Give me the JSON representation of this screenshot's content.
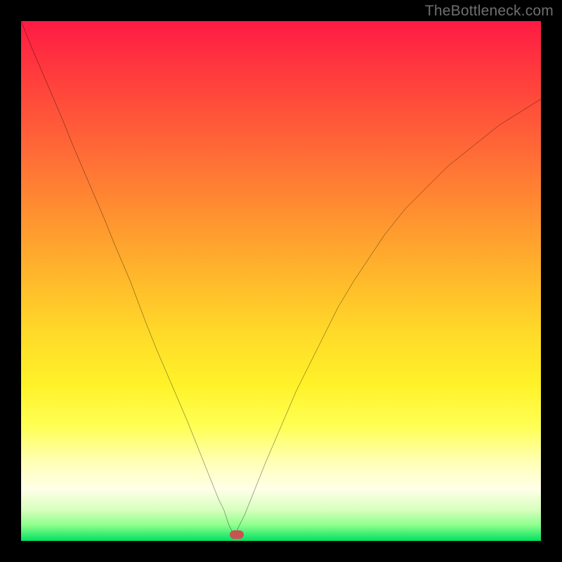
{
  "watermark": "TheBottleneck.com",
  "colors": {
    "frame": "#000000",
    "curve": "#000000",
    "marker": "#c95252"
  },
  "chart_data": {
    "type": "line",
    "title": "",
    "xlabel": "",
    "ylabel": "",
    "xlim": [
      0,
      100
    ],
    "ylim": [
      0,
      100
    ],
    "grid": false,
    "note": "x and y are percent of plot width/height; y=0 is bottom. Curve is a V-shaped function with a sharp minimum near x≈41.",
    "series": [
      {
        "name": "curve",
        "x": [
          0,
          2,
          5,
          8,
          10,
          13,
          16,
          18,
          21,
          24,
          26,
          29,
          32,
          34,
          36,
          38,
          39,
          40,
          41,
          42,
          43,
          45,
          47,
          50,
          53,
          56,
          58,
          61,
          64,
          66,
          70,
          74,
          78,
          82,
          87,
          92,
          100
        ],
        "y": [
          100,
          95,
          88,
          81,
          76,
          69,
          62,
          57,
          50,
          42,
          37,
          30,
          23,
          18,
          13,
          8,
          6,
          3,
          1,
          3,
          5,
          10,
          15,
          22,
          29,
          35,
          39,
          45,
          50,
          53,
          59,
          64,
          68,
          72,
          76,
          80,
          85
        ]
      }
    ],
    "marker": {
      "x": 41.5,
      "y": 1.2
    },
    "background_gradient": [
      {
        "stop": 0,
        "color": "#ff1a44"
      },
      {
        "stop": 10,
        "color": "#ff3b3d"
      },
      {
        "stop": 20,
        "color": "#ff5a39"
      },
      {
        "stop": 30,
        "color": "#ff7a34"
      },
      {
        "stop": 40,
        "color": "#ff9a2f"
      },
      {
        "stop": 50,
        "color": "#ffba2b"
      },
      {
        "stop": 60,
        "color": "#ffda29"
      },
      {
        "stop": 70,
        "color": "#fff229"
      },
      {
        "stop": 78,
        "color": "#ffff55"
      },
      {
        "stop": 85,
        "color": "#ffffb8"
      },
      {
        "stop": 90,
        "color": "#ffffe8"
      },
      {
        "stop": 94,
        "color": "#d8ffbe"
      },
      {
        "stop": 97,
        "color": "#8cff8c"
      },
      {
        "stop": 100,
        "color": "#00e060"
      }
    ]
  }
}
